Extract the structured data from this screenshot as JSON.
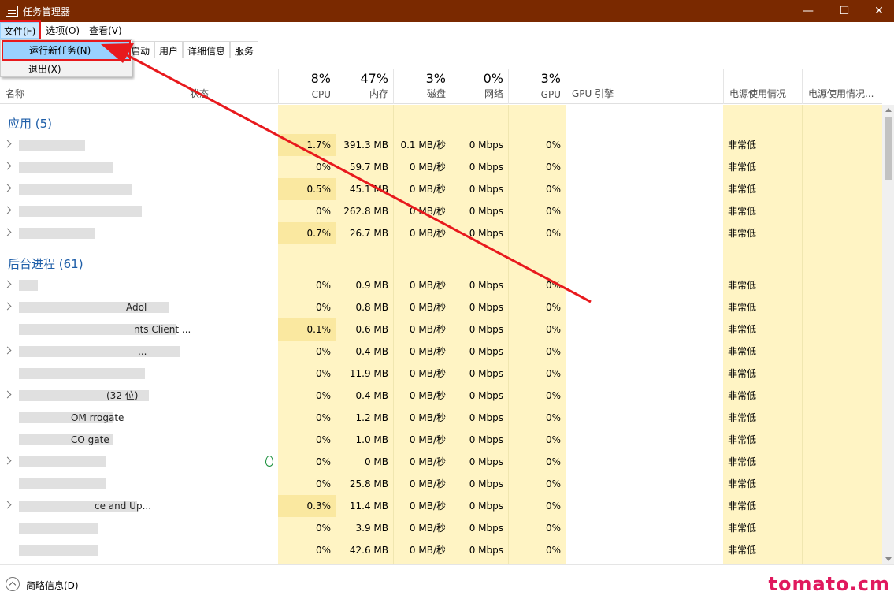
{
  "window": {
    "title": "任务管理器",
    "controls": [
      "minimize",
      "maximize",
      "close"
    ]
  },
  "menu": {
    "file": "文件(F)",
    "options": "选项(O)",
    "view": "查看(V)"
  },
  "file_menu": {
    "run_new_task": "运行新任务(N)",
    "exit": "退出(X)"
  },
  "tabs": [
    "启动",
    "用户",
    "详细信息",
    "服务"
  ],
  "columns": {
    "name": "名称",
    "status": "状态",
    "cpu": {
      "pct": "8%",
      "label": "CPU"
    },
    "memory": {
      "pct": "47%",
      "label": "内存"
    },
    "disk": {
      "pct": "3%",
      "label": "磁盘"
    },
    "network": {
      "pct": "0%",
      "label": "网络"
    },
    "gpu": {
      "pct": "3%",
      "label": "GPU"
    },
    "gpu_engine": "GPU 引擎",
    "power": "电源使用情况",
    "power_trend": "电源使用情况..."
  },
  "groups": {
    "apps": "应用 (5)",
    "background": "后台进程 (61)"
  },
  "apps": [
    {
      "name": "",
      "cpu": "1.7%",
      "mem": "391.3 MB",
      "disk": "0.1 MB/秒",
      "net": "0 Mbps",
      "gpu": "0%",
      "power": "非常低"
    },
    {
      "name": "",
      "cpu": "0%",
      "mem": "59.7 MB",
      "disk": "0 MB/秒",
      "net": "0 Mbps",
      "gpu": "0%",
      "power": "非常低"
    },
    {
      "name": "",
      "cpu": "0.5%",
      "mem": "45.1 MB",
      "disk": "0 MB/秒",
      "net": "0 Mbps",
      "gpu": "0%",
      "power": "非常低"
    },
    {
      "name": "",
      "cpu": "0%",
      "mem": "262.8 MB",
      "disk": "0 MB/秒",
      "net": "0 Mbps",
      "gpu": "0%",
      "power": "非常低"
    },
    {
      "name": "",
      "cpu": "0.7%",
      "mem": "26.7 MB",
      "disk": "0 MB/秒",
      "net": "0 Mbps",
      "gpu": "0%",
      "power": "非常低"
    }
  ],
  "background": [
    {
      "name": "",
      "cpu": "0%",
      "mem": "0.9 MB",
      "disk": "0 MB/秒",
      "net": "0 Mbps",
      "gpu": "0%",
      "power": "非常低"
    },
    {
      "name": "Adol",
      "cpu": "0%",
      "mem": "0.8 MB",
      "disk": "0 MB/秒",
      "net": "0 Mbps",
      "gpu": "0%",
      "power": "非常低"
    },
    {
      "name": "nts Client ...",
      "cpu": "0.1%",
      "mem": "0.6 MB",
      "disk": "0 MB/秒",
      "net": "0 Mbps",
      "gpu": "0%",
      "power": "非常低"
    },
    {
      "name": "...",
      "cpu": "0%",
      "mem": "0.4 MB",
      "disk": "0 MB/秒",
      "net": "0 Mbps",
      "gpu": "0%",
      "power": "非常低"
    },
    {
      "name": "",
      "cpu": "0%",
      "mem": "11.9 MB",
      "disk": "0 MB/秒",
      "net": "0 Mbps",
      "gpu": "0%",
      "power": "非常低"
    },
    {
      "name": "(32 位)",
      "cpu": "0%",
      "mem": "0.4 MB",
      "disk": "0 MB/秒",
      "net": "0 Mbps",
      "gpu": "0%",
      "power": "非常低"
    },
    {
      "name": "OM rrogate",
      "cpu": "0%",
      "mem": "1.2 MB",
      "disk": "0 MB/秒",
      "net": "0 Mbps",
      "gpu": "0%",
      "power": "非常低"
    },
    {
      "name": "CO gate",
      "cpu": "0%",
      "mem": "1.0 MB",
      "disk": "0 MB/秒",
      "net": "0 Mbps",
      "gpu": "0%",
      "power": "非常低"
    },
    {
      "name": "",
      "cpu": "0%",
      "mem": "0 MB",
      "disk": "0 MB/秒",
      "net": "0 Mbps",
      "gpu": "0%",
      "power": "非常低"
    },
    {
      "name": "",
      "cpu": "0%",
      "mem": "25.8 MB",
      "disk": "0 MB/秒",
      "net": "0 Mbps",
      "gpu": "0%",
      "power": "非常低"
    },
    {
      "name": "ce and Up...",
      "cpu": "0.3%",
      "mem": "11.4 MB",
      "disk": "0 MB/秒",
      "net": "0 Mbps",
      "gpu": "0%",
      "power": "非常低"
    },
    {
      "name": "",
      "cpu": "0%",
      "mem": "3.9 MB",
      "disk": "0 MB/秒",
      "net": "0 Mbps",
      "gpu": "0%",
      "power": "非常低"
    },
    {
      "name": "",
      "cpu": "0%",
      "mem": "42.6 MB",
      "disk": "0 MB/秒",
      "net": "0 Mbps",
      "gpu": "0%",
      "power": "非常低"
    }
  ],
  "footer": {
    "fewer_details": "简略信息(D)",
    "watermark": "tomato.cm"
  },
  "colors": {
    "titlebar": "#7a2900",
    "heat": "#fff4c4",
    "annotation": "#e8191d",
    "group_title": "#1e5ea8"
  }
}
